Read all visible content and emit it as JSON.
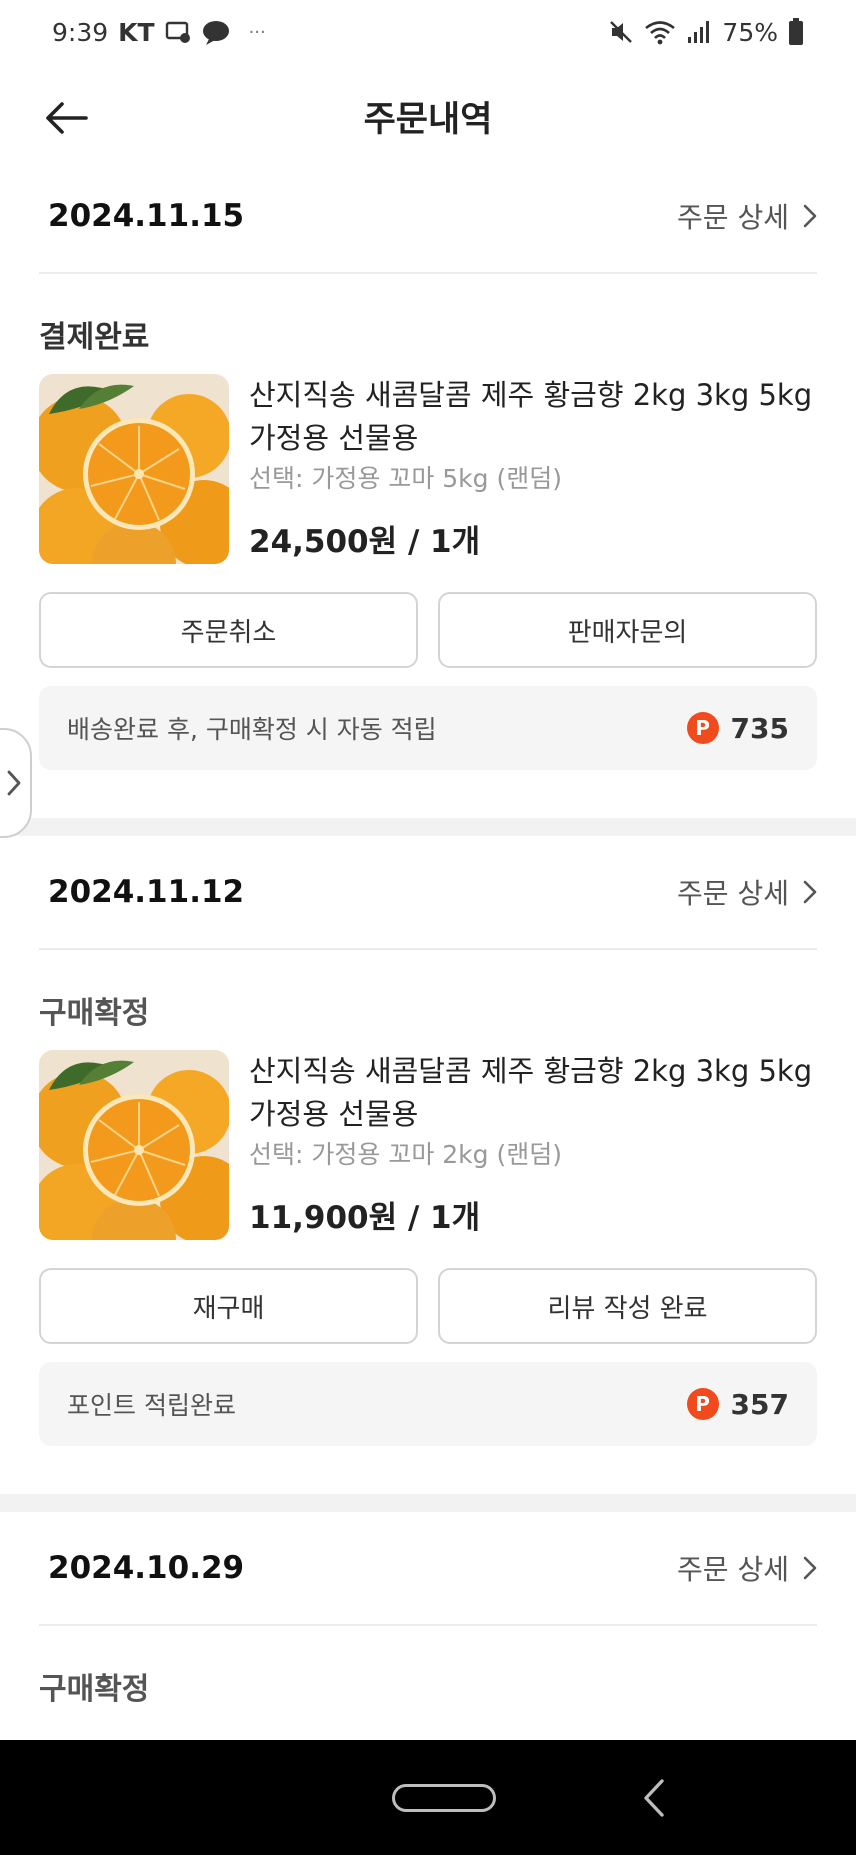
{
  "status_bar": {
    "time": "9:39",
    "carrier": "KT",
    "more": "···",
    "battery": "75%"
  },
  "header": {
    "title": "주문내역"
  },
  "orders": [
    {
      "date": "2024.11.15",
      "detail_label": "주문 상세",
      "status": "결제완료",
      "product_name": "산지직송 새콤달콤 제주 황금향 2kg 3kg 5kg 가정용 선물용",
      "option": "선택: 가정용 꼬마 5kg (랜덤)",
      "price": "24,500원 / 1개",
      "buttons": [
        "주문취소",
        "판매자문의"
      ],
      "point_text": "배송완료 후, 구매확정 시 자동 적립",
      "point_badge": "P",
      "point_value": "735"
    },
    {
      "date": "2024.11.12",
      "detail_label": "주문 상세",
      "status": "구매확정",
      "product_name": "산지직송 새콤달콤 제주 황금향 2kg 3kg 5kg 가정용 선물용",
      "option": "선택: 가정용 꼬마 2kg (랜덤)",
      "price": "11,900원 / 1개",
      "buttons": [
        "재구매",
        "리뷰 작성 완료"
      ],
      "point_text": "포인트 적립완료",
      "point_badge": "P",
      "point_value": "357"
    },
    {
      "date": "2024.10.29",
      "detail_label": "주문 상세",
      "status": "구매확정"
    }
  ],
  "colors": {
    "point_badge": "#f04a1d",
    "orange": "#f5a21b",
    "nav_bar": "#000000"
  }
}
